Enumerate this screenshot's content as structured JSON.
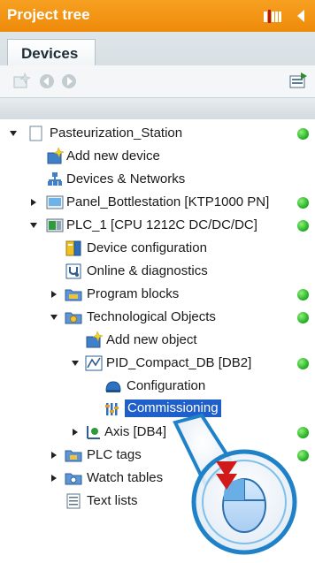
{
  "header": {
    "title": "Project tree"
  },
  "tabs": {
    "devices": "Devices"
  },
  "tree": {
    "items": [
      {
        "label": "Pasteurization_Station",
        "status": "ok"
      },
      {
        "label": "Add new device"
      },
      {
        "label": "Devices & Networks"
      },
      {
        "label": "Panel_Bottlestation [KTP1000 PN]",
        "status": "ok"
      },
      {
        "label": "PLC_1 [CPU 1212C DC/DC/DC]",
        "status": "ok"
      },
      {
        "label": "Device configuration"
      },
      {
        "label": "Online & diagnostics"
      },
      {
        "label": "Program blocks",
        "status": "ok"
      },
      {
        "label": "Technological Objects",
        "status": "ok"
      },
      {
        "label": "Add new object"
      },
      {
        "label": "PID_Compact_DB [DB2]",
        "status": "ok"
      },
      {
        "label": "Configuration"
      },
      {
        "label": "Commissioning"
      },
      {
        "label": "Axis [DB4]",
        "status": "ok"
      },
      {
        "label": "PLC tags",
        "status": "ok"
      },
      {
        "label": "Watch tables"
      },
      {
        "label": "Text lists"
      }
    ]
  },
  "colors": {
    "titlebar": "#f29116",
    "selection": "#1f5fc9",
    "status_ok": "#2bb52b"
  },
  "icons": {
    "pin": "pin-icon",
    "collapse": "collapse-arrow-icon",
    "mouse": "mouse-double-click-icon"
  }
}
